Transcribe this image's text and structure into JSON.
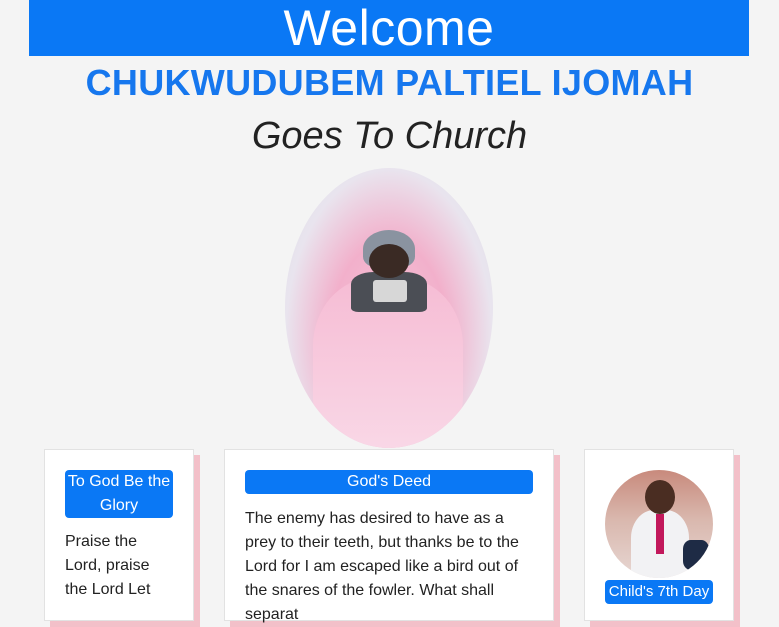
{
  "header": {
    "welcome": "Welcome",
    "name": "CHUKWUDUBEM PALTIEL IJOMAH",
    "subtitle": "Goes To Church"
  },
  "photo": {
    "alt": "baby photo"
  },
  "cards": [
    {
      "title": "To God Be the Glory",
      "text": "Praise the Lord, praise the Lord Let"
    },
    {
      "title": "God's Deed",
      "text": "The enemy has desired to have as a prey to their teeth, but thanks be to the Lord for I am escaped like a bird out of the snares of the fowler. What shall separat"
    },
    {
      "title": "Child's 7th Day"
    }
  ],
  "colors": {
    "accent": "#0a78f5",
    "name": "#1677ee",
    "shadow": "#f3c0c9"
  }
}
